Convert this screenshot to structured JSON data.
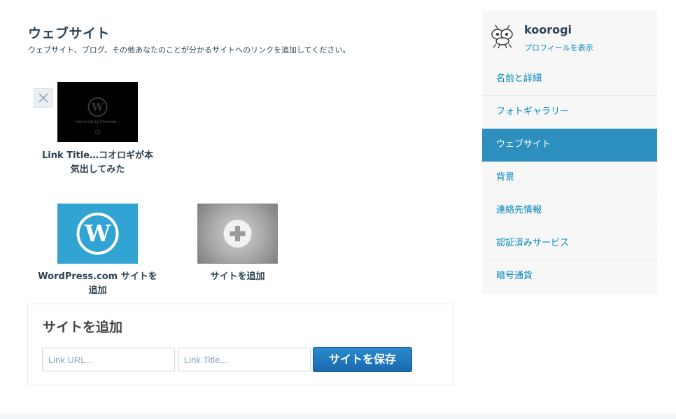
{
  "page": {
    "title": "ウェブサイト",
    "description": "ウェブサイト、ブログ、その他あなたのことが分かるサイトへのリンクを追加してください。"
  },
  "sites": [
    {
      "caption_line1": "Link Title…コオロギが本",
      "caption_line2": "気出してみた",
      "thumb_text": "Generating Preview..."
    },
    {
      "caption_line1": "WordPress.com サイトを",
      "caption_line2": "追加"
    },
    {
      "caption_line1": "サイトを追加",
      "caption_line2": ""
    }
  ],
  "add_panel": {
    "title": "サイトを追加",
    "url_placeholder": "Link URL...",
    "title_placeholder": "Link Title...",
    "save_label": "サイトを保存"
  },
  "sidebar": {
    "username": "koorogi",
    "profile_link": "プロフィールを表示",
    "items": [
      {
        "label": "名前と詳細"
      },
      {
        "label": "フォトギャラリー"
      },
      {
        "label": "ウェブサイト"
      },
      {
        "label": "背景"
      },
      {
        "label": "連絡先情報"
      },
      {
        "label": "認証済みサービス"
      },
      {
        "label": "暗号通貨"
      }
    ],
    "active_index": 2
  },
  "colors": {
    "accent": "#2c8fbd",
    "link": "#0087be",
    "wordpress_blue": "#31a4d3",
    "button": "#1e76bb"
  }
}
